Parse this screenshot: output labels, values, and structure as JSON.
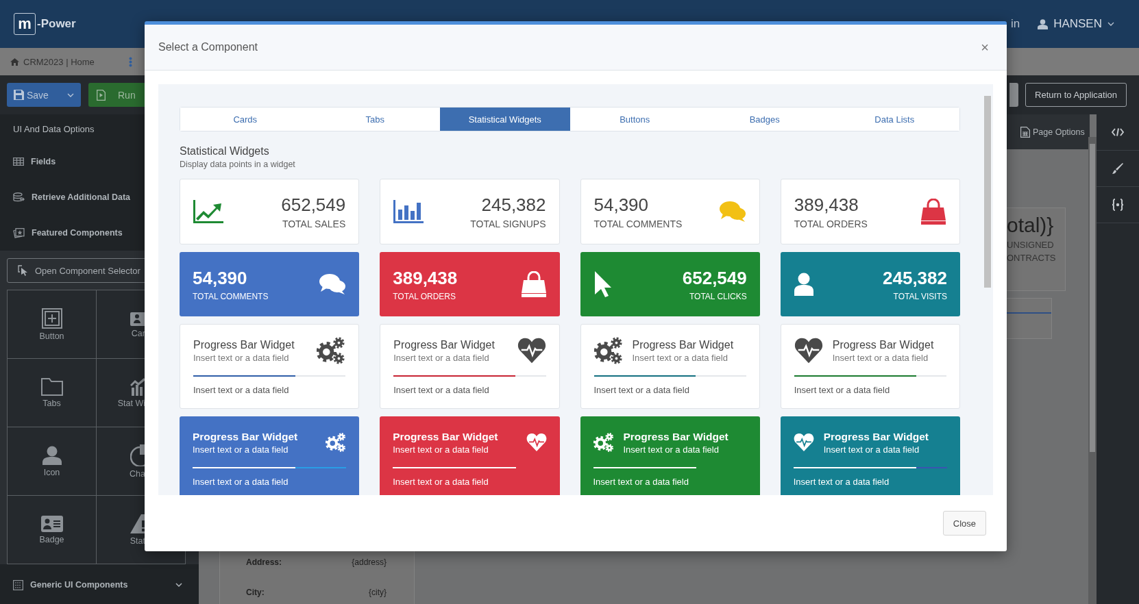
{
  "header": {
    "logo_mark": "m",
    "logo_text": "-Power",
    "menu_fragment": "in",
    "user": "HANSEN"
  },
  "breadcrumb": "CRM2023 | Home",
  "toolbar": {
    "save": "Save",
    "run": "Run",
    "return": "Return to Application"
  },
  "sidebar": {
    "heading": "UI And Data Options",
    "items": [
      {
        "label": "Fields"
      },
      {
        "label": "Retrieve Additional Data"
      },
      {
        "label": "Featured Components"
      }
    ],
    "selector_button": "Open Component Selector",
    "tiles": [
      {
        "label": "Button"
      },
      {
        "label": "Car"
      },
      {
        "label": "Tabs"
      },
      {
        "label": "Stat Wi"
      },
      {
        "label": "Icon"
      },
      {
        "label": "Cha"
      },
      {
        "label": "Badge"
      },
      {
        "label": "Stat"
      }
    ],
    "footer": "Generic UI Components"
  },
  "page_options": "Page Options",
  "canvas": {
    "fragments": [
      "otal)}",
      "UNSIGNED",
      "ONTRACTS"
    ],
    "fields": [
      {
        "label": "Address:",
        "value": "{address}"
      },
      {
        "label": "City:",
        "value": "{city}"
      }
    ]
  },
  "modal": {
    "title": "Select a Component",
    "close_icon": "×",
    "tabs": [
      {
        "label": "Cards",
        "selected": false
      },
      {
        "label": "Tabs",
        "selected": false
      },
      {
        "label": "Statistical Widgets",
        "selected": true
      },
      {
        "label": "Buttons",
        "selected": false
      },
      {
        "label": "Badges",
        "selected": false
      },
      {
        "label": "Data Lists",
        "selected": false
      }
    ],
    "heading": "Statistical Widgets",
    "subheading": "Display data points in a widget",
    "widgets": [
      {
        "kind": "stat",
        "value": "652,549",
        "label": "TOTAL SALES",
        "color": "#1e8a33"
      },
      {
        "kind": "stat",
        "value": "245,382",
        "label": "TOTAL SIGNUPS",
        "color": "#4472c4"
      },
      {
        "kind": "stat",
        "value": "54,390",
        "label": "TOTAL COMMENTS",
        "color": "#f2c014"
      },
      {
        "kind": "stat",
        "value": "389,438",
        "label": "TOTAL ORDERS",
        "color": "#dc3545"
      },
      {
        "kind": "solidstat",
        "value": "54,390",
        "label": "TOTAL COMMENTS",
        "color": "#4472c4"
      },
      {
        "kind": "solidstat",
        "value": "389,438",
        "label": "TOTAL ORDERS",
        "color": "#dc3545"
      },
      {
        "kind": "solidstat",
        "value": "652,549",
        "label": "TOTAL CLICKS",
        "color": "#1e8a33"
      },
      {
        "kind": "solidstat",
        "value": "245,382",
        "label": "TOTAL VISITS",
        "color": "#158091"
      },
      {
        "kind": "progress",
        "title": "Progress Bar Widget",
        "subtitle": "Insert text or a data field",
        "footer": "Insert text or a data field",
        "level": 0.67,
        "color": "#2f5ea8"
      },
      {
        "kind": "progress",
        "title": "Progress Bar Widget",
        "subtitle": "Insert text or a data field",
        "footer": "Insert text or a data field",
        "level": 0.8,
        "color": "#c82333"
      },
      {
        "kind": "progress",
        "title": "Progress Bar Widget",
        "subtitle": "Insert text or a data field",
        "footer": "Insert text or a data field",
        "level": 0.67,
        "color": "#136f80"
      },
      {
        "kind": "progress",
        "title": "Progress Bar Widget",
        "subtitle": "Insert text or a data field",
        "footer": "Insert text or a data field",
        "level": 0.8,
        "color": "#1a7a2e"
      },
      {
        "kind": "solidprogress",
        "title": "Progress Bar Widget",
        "subtitle": "Insert text or a data field",
        "footer": "Insert text or a data field",
        "level": 0.67,
        "color": "#4472c4",
        "track": {
          "color": "#2a9ee6"
        }
      },
      {
        "kind": "solidprogress",
        "title": "Progress Bar Widget",
        "subtitle": "Insert text or a data field",
        "footer": "Insert text or a data field",
        "level": 0.8,
        "color": "#dc3545"
      },
      {
        "kind": "solidprogress",
        "title": "Progress Bar Widget",
        "subtitle": "Insert text or a data field",
        "footer": "Insert text or a data field",
        "level": 0.67,
        "color": "#1e8a33"
      },
      {
        "kind": "solidprogress",
        "title": "Progress Bar Widget",
        "subtitle": "Insert text or a data field",
        "footer": "Insert text or a data field",
        "level": 0.8,
        "color": "#158091",
        "track": {
          "color": "#3a55b0"
        }
      }
    ],
    "close_button": "Close"
  }
}
